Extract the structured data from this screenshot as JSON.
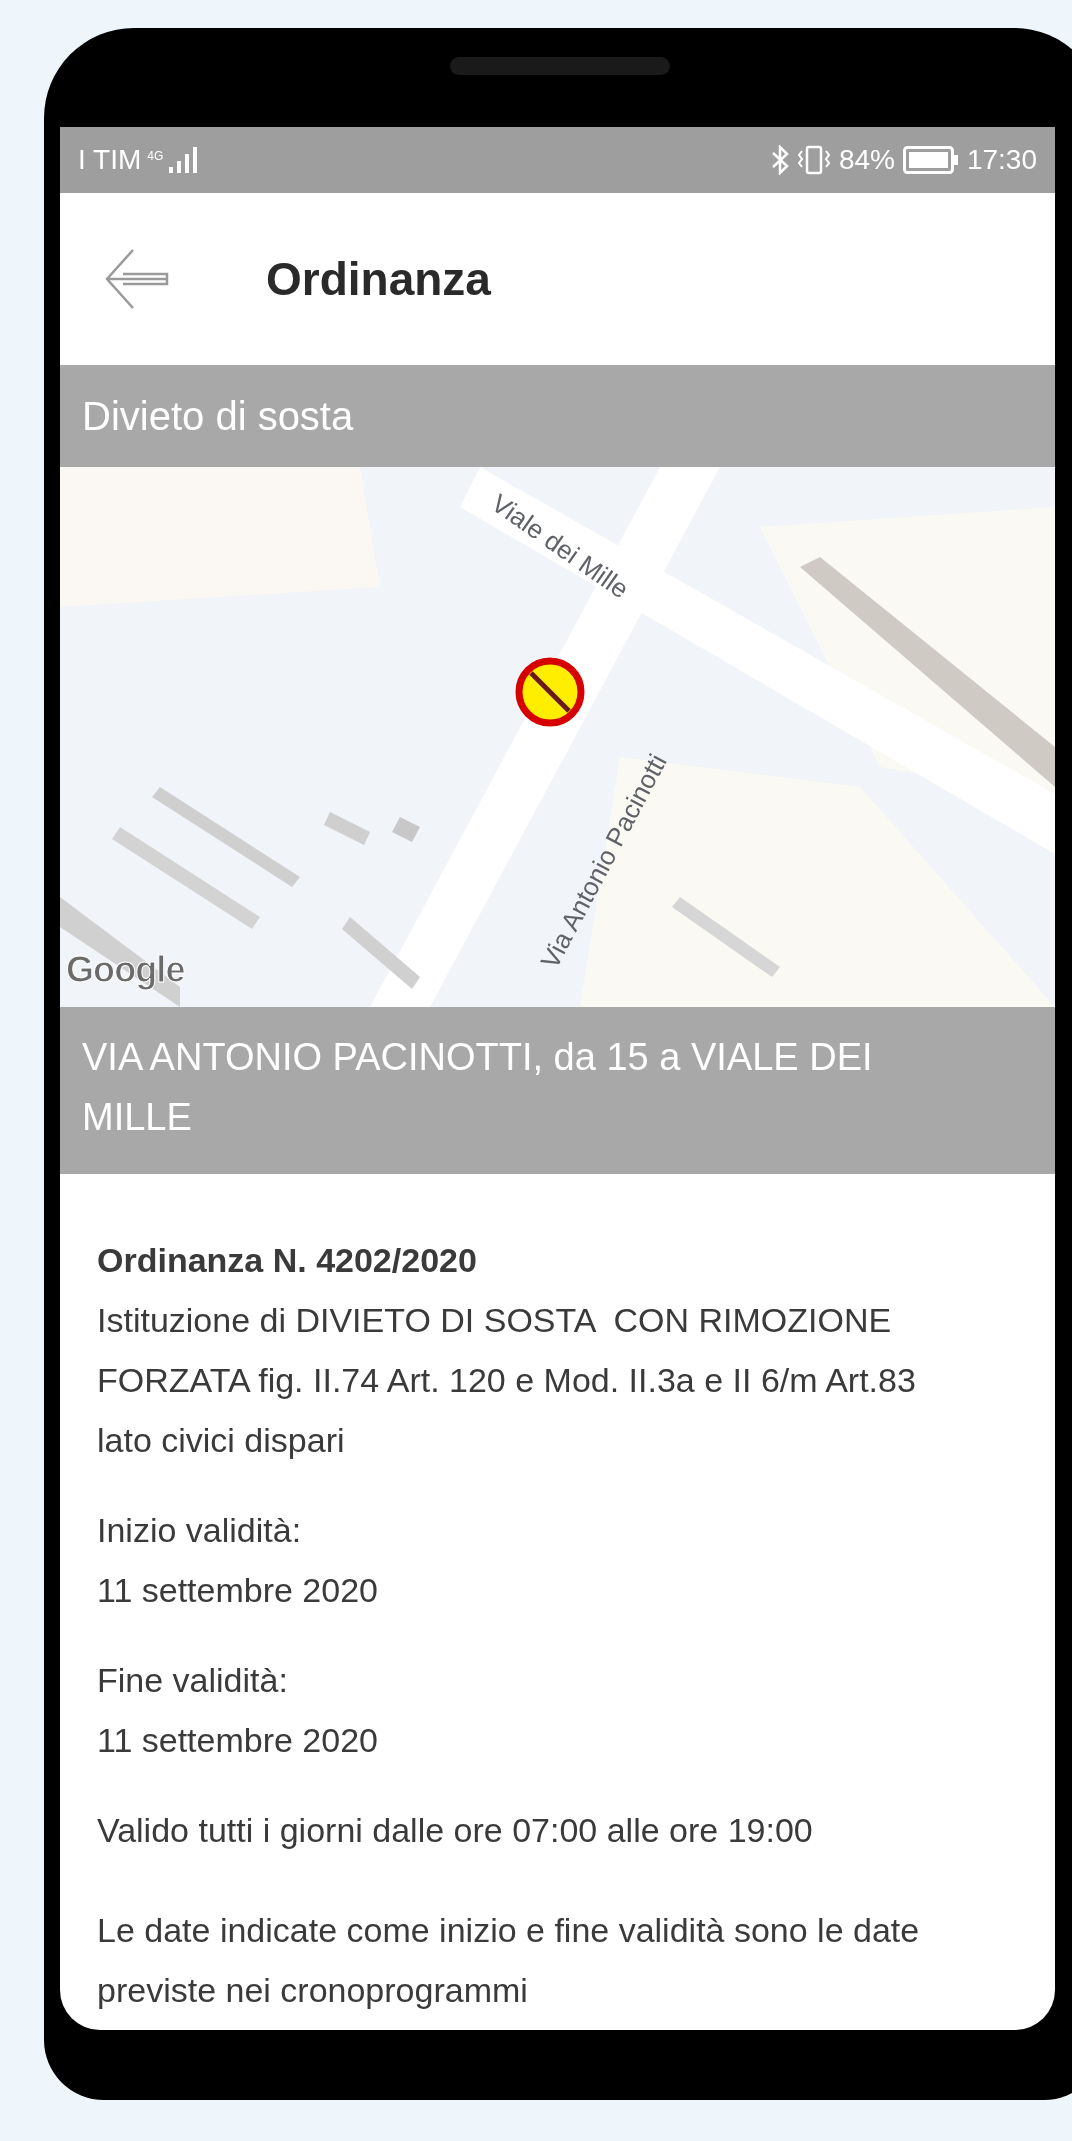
{
  "status_bar": {
    "carrier": "I TIM",
    "network": "4G",
    "battery_percent": "84%",
    "time": "17:30"
  },
  "header": {
    "title": "Ordinanza"
  },
  "category": "Divieto di sosta",
  "map": {
    "street_labels": [
      "Viale dei Mille",
      "Via Antonio Pacinotti"
    ],
    "attribution": "Google"
  },
  "address": "VIA ANTONIO PACINOTTI, da 15 a VIALE DEI MILLE",
  "details": {
    "number": "Ordinanza N. 4202/2020",
    "description": "Istituzione di DIVIETO DI SOSTA  CON RIMOZIONE FORZATA fig. II.74 Art. 120 e Mod. II.3a e II 6/m Art.83    lato civici dispari",
    "fields": [
      {
        "label": "Inizio validità:",
        "value": "11 settembre 2020"
      },
      {
        "label": "Fine validità:",
        "value": "11 settembre 2020"
      }
    ],
    "schedule": "Valido tutti i giorni dalle ore 07:00 alle ore 19:00",
    "note": "Le date indicate come inizio e fine validità sono le date previste nei cronoprogrammi"
  }
}
